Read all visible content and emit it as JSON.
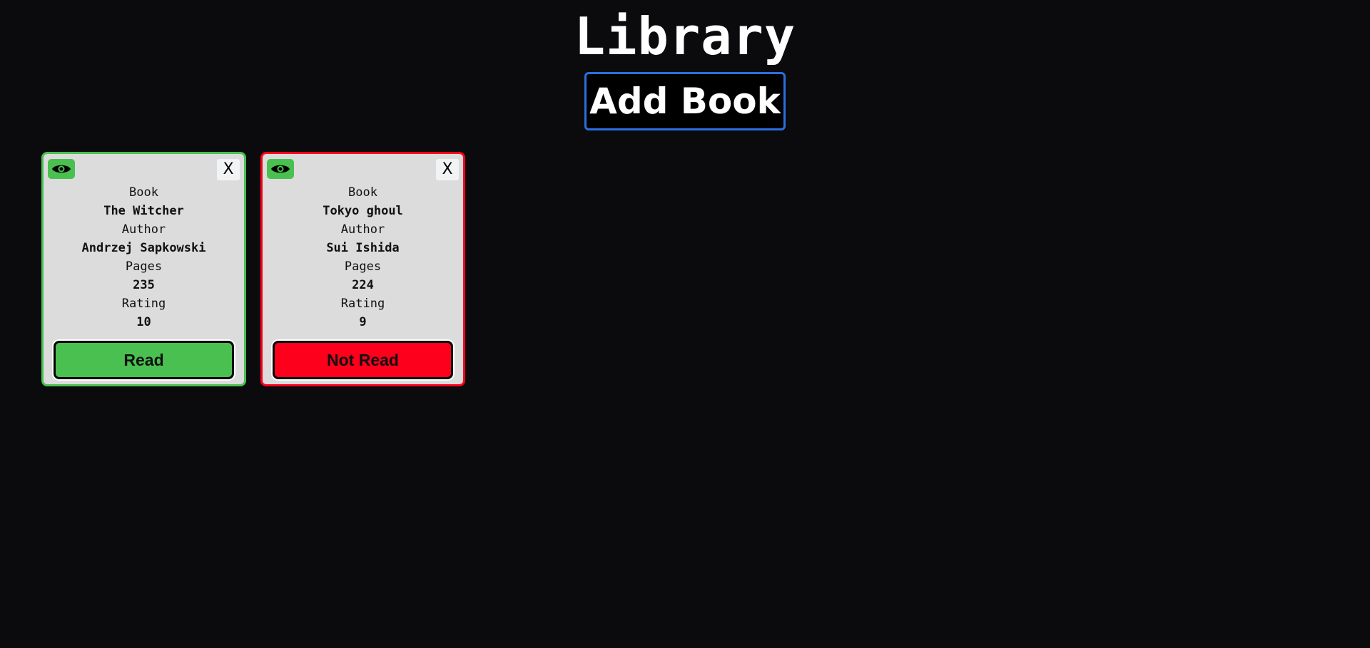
{
  "header": {
    "title": "Library",
    "add_book_label": "Add Book"
  },
  "colors": {
    "background": "#0b0b0e",
    "read": "#4ac050",
    "not_read": "#fc001c",
    "accent_border": "#2a6fe0"
  },
  "cards": [
    {
      "book_label": "Book",
      "book": "The Witcher",
      "author_label": "Author",
      "author": "Andrzej Sapkowski",
      "pages_label": "Pages",
      "pages": "235",
      "rating_label": "Rating",
      "rating": "10",
      "status": "Read",
      "close_label": "X",
      "icon": "eye-icon"
    },
    {
      "book_label": "Book",
      "book": "Tokyo ghoul",
      "author_label": "Author",
      "author": "Sui Ishida",
      "pages_label": "Pages",
      "pages": "224",
      "rating_label": "Rating",
      "rating": "9",
      "status": "Not Read",
      "close_label": "X",
      "icon": "eye-icon"
    }
  ]
}
